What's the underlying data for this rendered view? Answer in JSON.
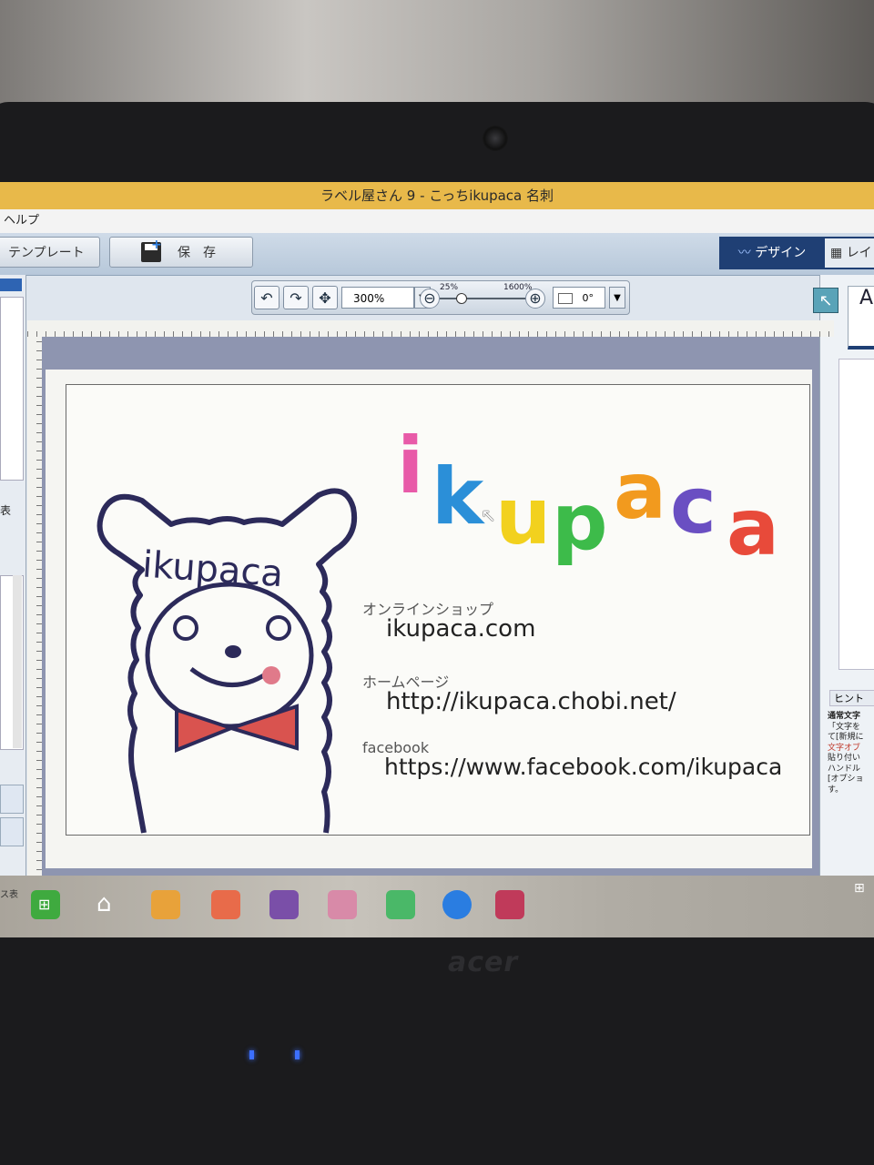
{
  "window": {
    "title": "ラベル屋さん 9 - こっちikupaca 名刺"
  },
  "menu": {
    "help": "ヘルプ"
  },
  "toolbar": {
    "template_label": "テンプレート",
    "save_label": "保　存"
  },
  "mode_tabs": {
    "design": "デザイン",
    "layout": "レイ"
  },
  "view_tools": {
    "zoom_value": "300%",
    "zoom_min": "25%",
    "zoom_max": "1600%",
    "zoom_level_percent": 300,
    "rotation_value": "0°"
  },
  "left_panel": {
    "label": "表"
  },
  "right_panel": {
    "hint_title": "ヒント",
    "hint_text": [
      "通常文字",
      "「文字を",
      "て[新規に",
      "文字オブ",
      "貼り付い",
      "ハンドル",
      "[オプショ",
      "す。"
    ]
  },
  "card": {
    "logo_letters": [
      {
        "char": "i",
        "color": "#e85aa8"
      },
      {
        "char": "k",
        "color": "#2b8fd8"
      },
      {
        "char": "u",
        "color": "#f2d11e"
      },
      {
        "char": "p",
        "color": "#3dbb4a"
      },
      {
        "char": "a",
        "color": "#f29a1e"
      },
      {
        "char": "c",
        "color": "#6a4fc2"
      },
      {
        "char": "a",
        "color": "#e84a3a"
      }
    ],
    "mascot_text": "ikupaca",
    "shop_label": "オンラインショップ",
    "shop_value": "ikupaca.com",
    "home_label": "ホームページ",
    "home_value": "http://ikupaca.chobi.net/",
    "fb_label": "facebook",
    "fb_value": "https://www.facebook.com/ikupaca"
  },
  "taskbar": {
    "tray_text": "ス表"
  },
  "laptop": {
    "brand": "acer"
  }
}
